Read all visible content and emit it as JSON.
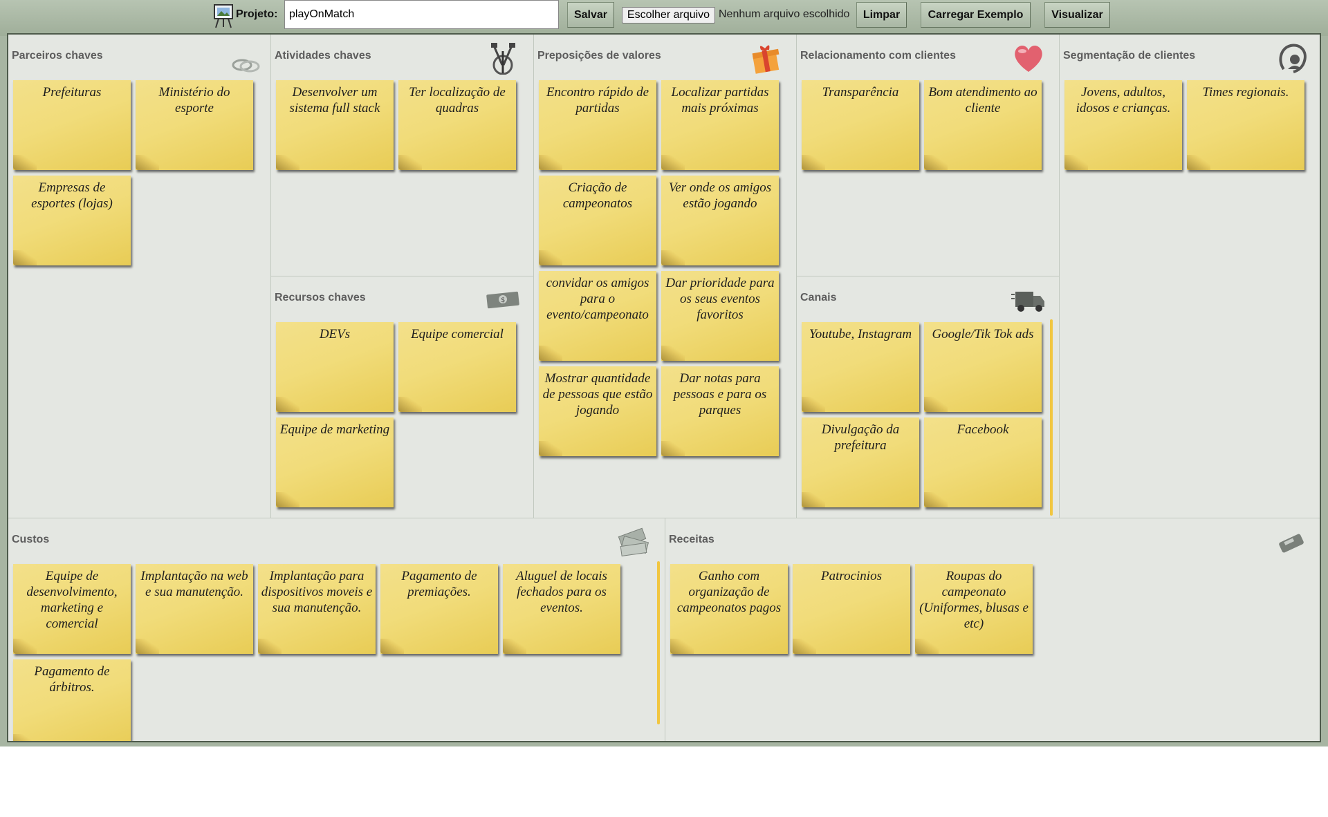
{
  "toolbar": {
    "project_label": "Projeto:",
    "project_name": "playOnMatch",
    "save_label": "Salvar",
    "choose_file_label": "Escolher arquivo",
    "no_file_text": "Nenhum arquivo escolhido",
    "clear_label": "Limpar",
    "load_example_label": "Carregar Exemplo",
    "view_label": "Visualizar"
  },
  "canvas": {
    "key_partners": {
      "title": "Parceiros chaves",
      "icon": "rings-icon",
      "notes": [
        "Prefeituras",
        "Ministério do esporte",
        "Empresas de esportes (lojas)"
      ]
    },
    "key_activities": {
      "title": "Atividades chaves",
      "icon": "tools-icon",
      "notes": [
        "Desenvolver um sistema full stack",
        "Ter localização de quadras"
      ]
    },
    "key_resources": {
      "title": "Recursos chaves",
      "icon": "money-bill-icon",
      "notes": [
        "DEVs",
        "Equipe comercial",
        "Equipe de marketing"
      ]
    },
    "value_propositions": {
      "title": "Preposições de valores",
      "icon": "gift-icon",
      "notes": [
        "Encontro rápido de partidas",
        "Localizar partidas mais próximas",
        "Criação de campeonatos",
        "Ver onde os amigos estão jogando",
        "convidar os amigos para o evento/campeonato",
        "Dar prioridade para os seus eventos favoritos",
        "Mostrar quantidade de pessoas que estão jogando",
        "Dar notas para pessoas e para os parques"
      ]
    },
    "customer_relationships": {
      "title": "Relacionamento com clientes",
      "icon": "heart-icon",
      "notes": [
        "Transparência",
        "Bom atendimento ao cliente"
      ]
    },
    "channels": {
      "title": "Canais",
      "icon": "truck-icon",
      "notes": [
        "Youtube, Instagram",
        "Google/Tik Tok ads",
        "Divulgação da prefeitura",
        "Facebook"
      ]
    },
    "customer_segments": {
      "title": "Segmentação de clientes",
      "icon": "mother-child-icon",
      "notes": [
        "Jovens, adultos, idosos e crianças.",
        "Times regionais."
      ]
    },
    "costs": {
      "title": "Custos",
      "icon": "cash-pile-icon",
      "notes": [
        "Equipe de desenvolvimento, marketing e comercial",
        "Implantação na web e sua manutenção.",
        "Implantação para dispositivos moveis e sua manutenção.",
        "Pagamento de premiações.",
        "Aluguel de locais fechados para os eventos.",
        "Pagamento de árbitros."
      ]
    },
    "revenue": {
      "title": "Receitas",
      "icon": "card-machine-icon",
      "notes": [
        "Ganho com organização de campeonatos pagos",
        "Patrocinios",
        "Roupas do campeonato (Uniformes, blusas e etc)"
      ]
    }
  }
}
